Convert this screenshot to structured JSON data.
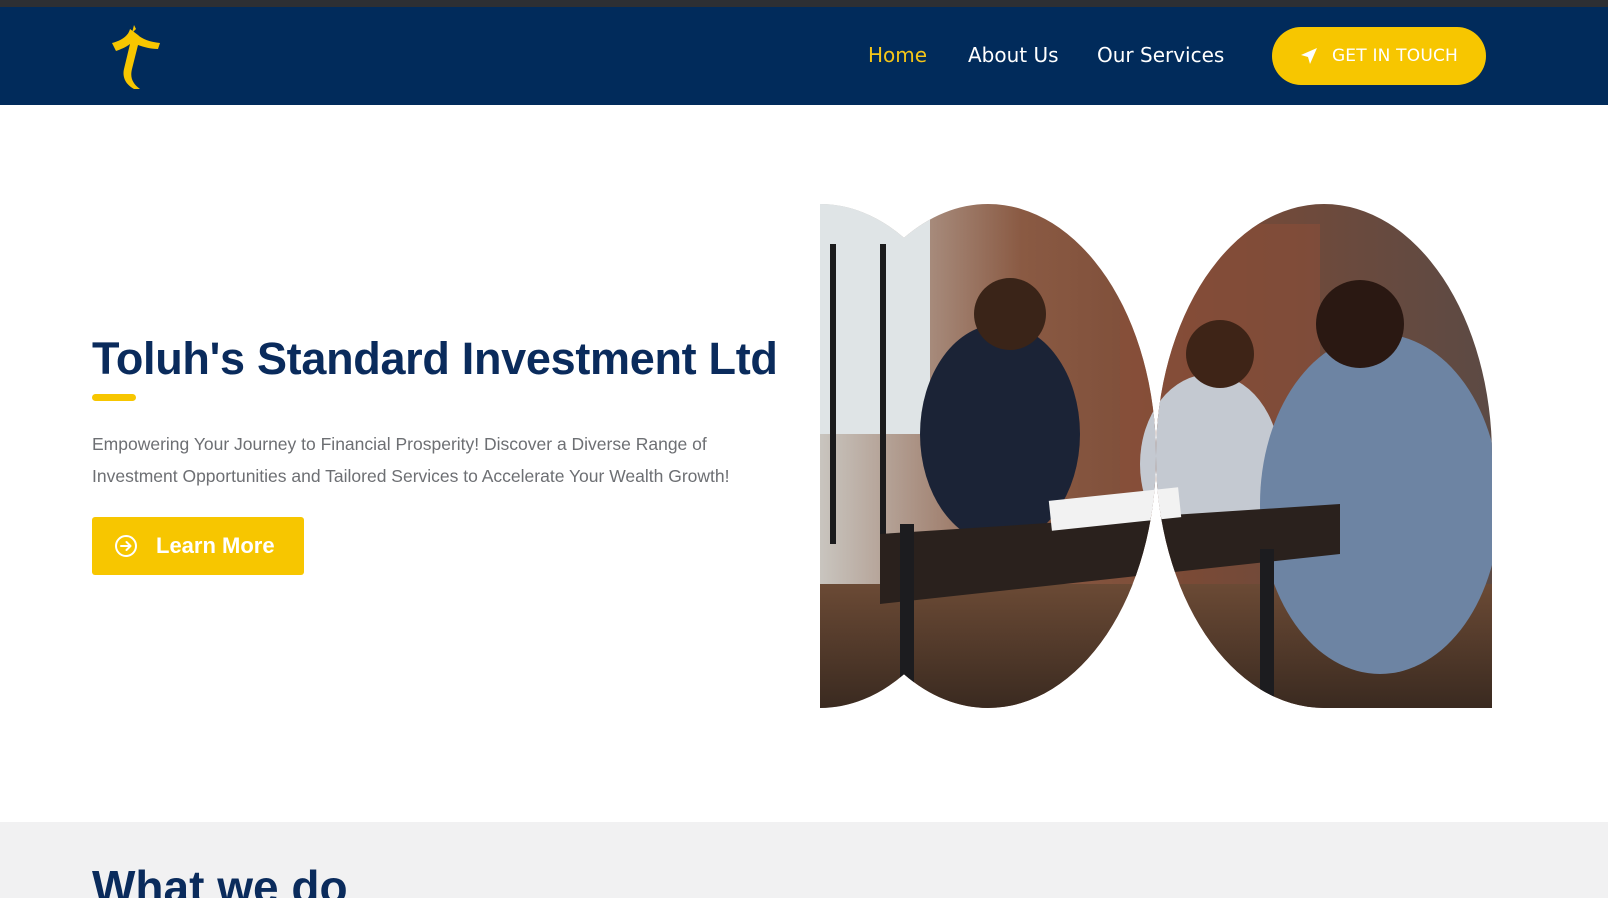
{
  "brand": {
    "accent": "#f7c600",
    "navy": "#012b5b",
    "logo_icon": "logo-mark-icon"
  },
  "nav": {
    "items": [
      {
        "label": "Home",
        "active": true
      },
      {
        "label": "About Us",
        "active": false
      },
      {
        "label": "Our Services",
        "active": false
      }
    ],
    "cta": {
      "label": "GET IN TOUCH",
      "icon": "paper-plane-icon"
    }
  },
  "hero": {
    "title": "Toluh's Standard Investment Ltd",
    "description": "Empowering Your Journey to Financial Prosperity! Discover a Diverse Range of Investment Opportunities and Tailored Services to Accelerate Your Wealth Growth!",
    "button": {
      "label": "Learn More",
      "icon": "arrow-circle-right-icon"
    },
    "image": {
      "icon": "business-meeting-photo"
    }
  },
  "section2": {
    "title": "What we do"
  }
}
